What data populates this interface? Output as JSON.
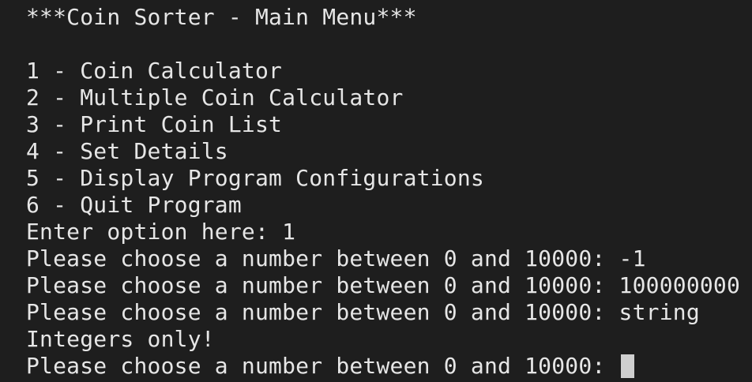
{
  "terminal": {
    "lines": [
      "***Coin Sorter - Main Menu***",
      "",
      "1 - Coin Calculator",
      "2 - Multiple Coin Calculator",
      "3 - Print Coin List",
      "4 - Set Details",
      "5 - Display Program Configurations",
      "6 - Quit Program",
      "Enter option here: 1",
      "Please choose a number between 0 and 10000: -1",
      "Please choose a number between 0 and 10000: 100000000",
      "Please choose a number between 0 and 10000: string",
      "Integers only!",
      "Please choose a number between 0 and 10000: "
    ],
    "colors": {
      "background": "#1e1e1e",
      "text": "#e6e6e6",
      "cursor": "#cfcfcf"
    }
  }
}
